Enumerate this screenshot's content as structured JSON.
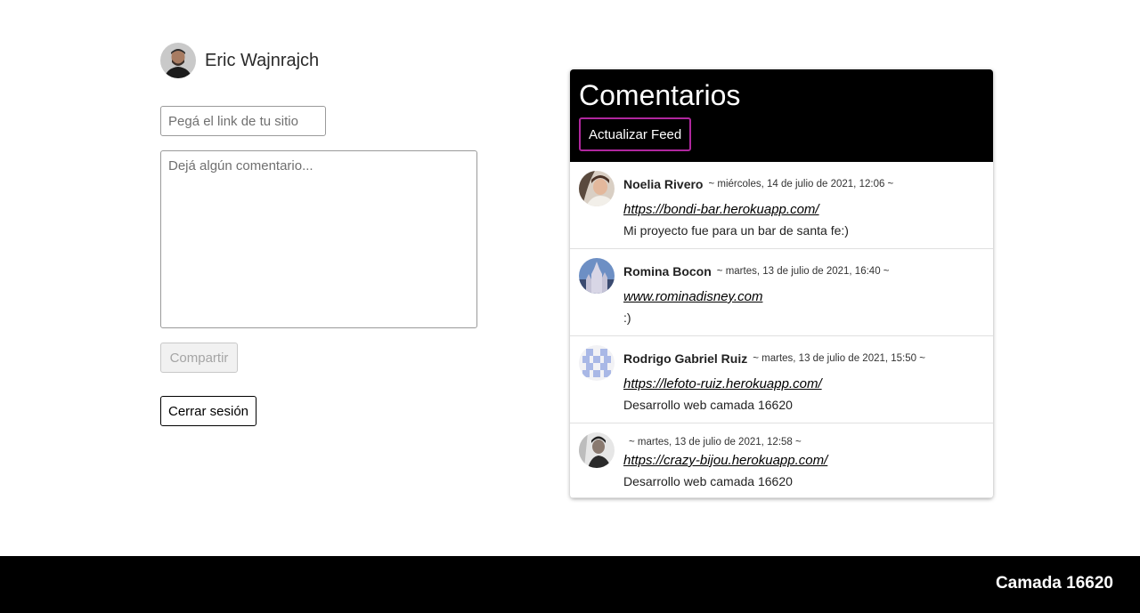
{
  "user": {
    "name": "Eric Wajnrajch"
  },
  "form": {
    "link_placeholder": "Pegá el link de tu sitio",
    "comment_placeholder": "Dejá algún comentario...",
    "share_label": "Compartir",
    "logout_label": "Cerrar sesión"
  },
  "panel": {
    "title": "Comentarios",
    "refresh_label": "Actualizar Feed",
    "comments": [
      {
        "author": "Noelia Rivero",
        "date": "~ miércoles, 14 de julio de 2021, 12:06 ~",
        "link": "https://bondi-bar.herokuapp.com/",
        "text": "Mi proyecto fue para un bar de santa fe:)"
      },
      {
        "author": "Romina Bocon",
        "date": "~ martes, 13 de julio de 2021, 16:40 ~",
        "link": "www.rominadisney.com",
        "text": ":)"
      },
      {
        "author": "Rodrigo Gabriel Ruiz",
        "date": "~ martes, 13 de julio de 2021, 15:50 ~",
        "link": "https://lefoto-ruiz.herokuapp.com/",
        "text": "Desarrollo web camada 16620"
      },
      {
        "author": "",
        "date": "~ martes, 13 de julio de 2021, 12:58 ~",
        "link": "https://crazy-bijou.herokuapp.com/",
        "text": "Desarrollo web camada 16620"
      }
    ]
  },
  "footer": {
    "text": "Camada 16620"
  }
}
